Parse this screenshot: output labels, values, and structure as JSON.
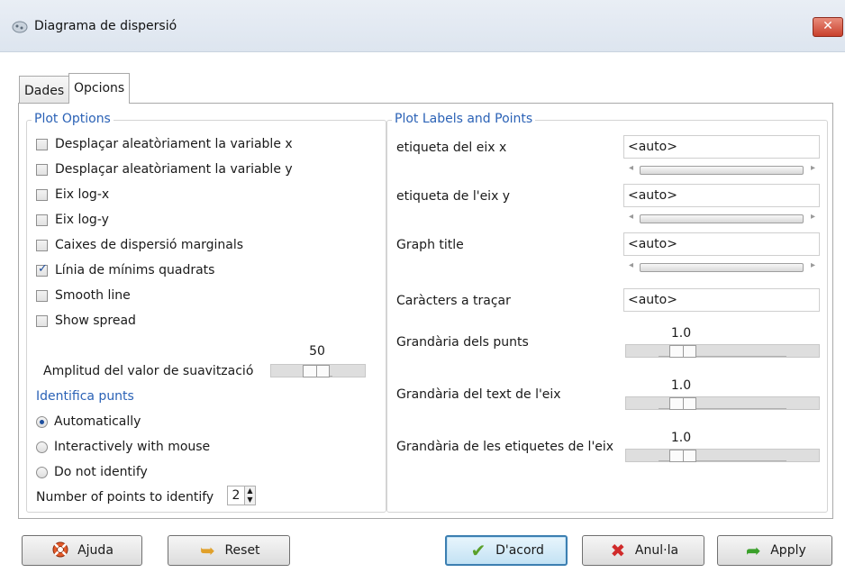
{
  "window": {
    "title": "Diagrama de dispersió",
    "close_label": "✕"
  },
  "tabs": [
    {
      "label": "Dades",
      "active": false
    },
    {
      "label": "Opcions",
      "active": true
    }
  ],
  "plot_options": {
    "title": "Plot Options",
    "checkboxes": [
      {
        "label": "Desplaçar aleatòriament la variable x",
        "checked": false
      },
      {
        "label": "Desplaçar aleatòriament la variable y",
        "checked": false
      },
      {
        "label": "Eix log-x",
        "checked": false
      },
      {
        "label": "Eix log-y",
        "checked": false
      },
      {
        "label": "Caixes de dispersió marginals",
        "checked": false
      },
      {
        "label": "Línia de mínims quadrats",
        "checked": true
      },
      {
        "label": "Smooth line",
        "checked": false
      },
      {
        "label": "Show spread",
        "checked": false
      }
    ],
    "span_slider": {
      "label": "Amplitud del valor de suavització",
      "value": "50",
      "fraction": 0.5
    },
    "identify": {
      "title": "Identifica punts",
      "options": [
        {
          "label": "Automatically",
          "selected": true
        },
        {
          "label": "Interactively with mouse",
          "selected": false
        },
        {
          "label": "Do not identify",
          "selected": false
        }
      ],
      "count_label": "Number of points to identify",
      "count_value": "2"
    }
  },
  "plot_labels": {
    "title": "Plot Labels and Points",
    "fields": [
      {
        "label": "etiqueta del eix x",
        "value": "<auto>"
      },
      {
        "label": "etiqueta de l'eix y",
        "value": "<auto>"
      },
      {
        "label": "Graph title",
        "value": "<auto>"
      },
      {
        "label": "Caràcters a traçar",
        "value": "<auto>"
      }
    ],
    "sliders": [
      {
        "label": "Grandària dels punts",
        "value": "1.0",
        "fraction": 0.25
      },
      {
        "label": "Grandària del text de l'eix",
        "value": "1.0",
        "fraction": 0.25
      },
      {
        "label": "Grandària de les etiquetes de l'eix",
        "value": "1.0",
        "fraction": 0.25
      }
    ]
  },
  "buttons": {
    "help": "Ajuda",
    "reset": "Reset",
    "ok": "D'acord",
    "cancel": "Anul·la",
    "apply": "Apply"
  },
  "icons": {
    "app": "scatterplot-app-icon",
    "help": "lifebuoy-icon",
    "reset": "undo-arrow-icon",
    "ok": "checkmark-icon",
    "cancel": "red-x-icon",
    "apply": "green-arrow-icon"
  },
  "colors": {
    "group_title": "#2b62b6",
    "close_button": "#c9402c"
  }
}
